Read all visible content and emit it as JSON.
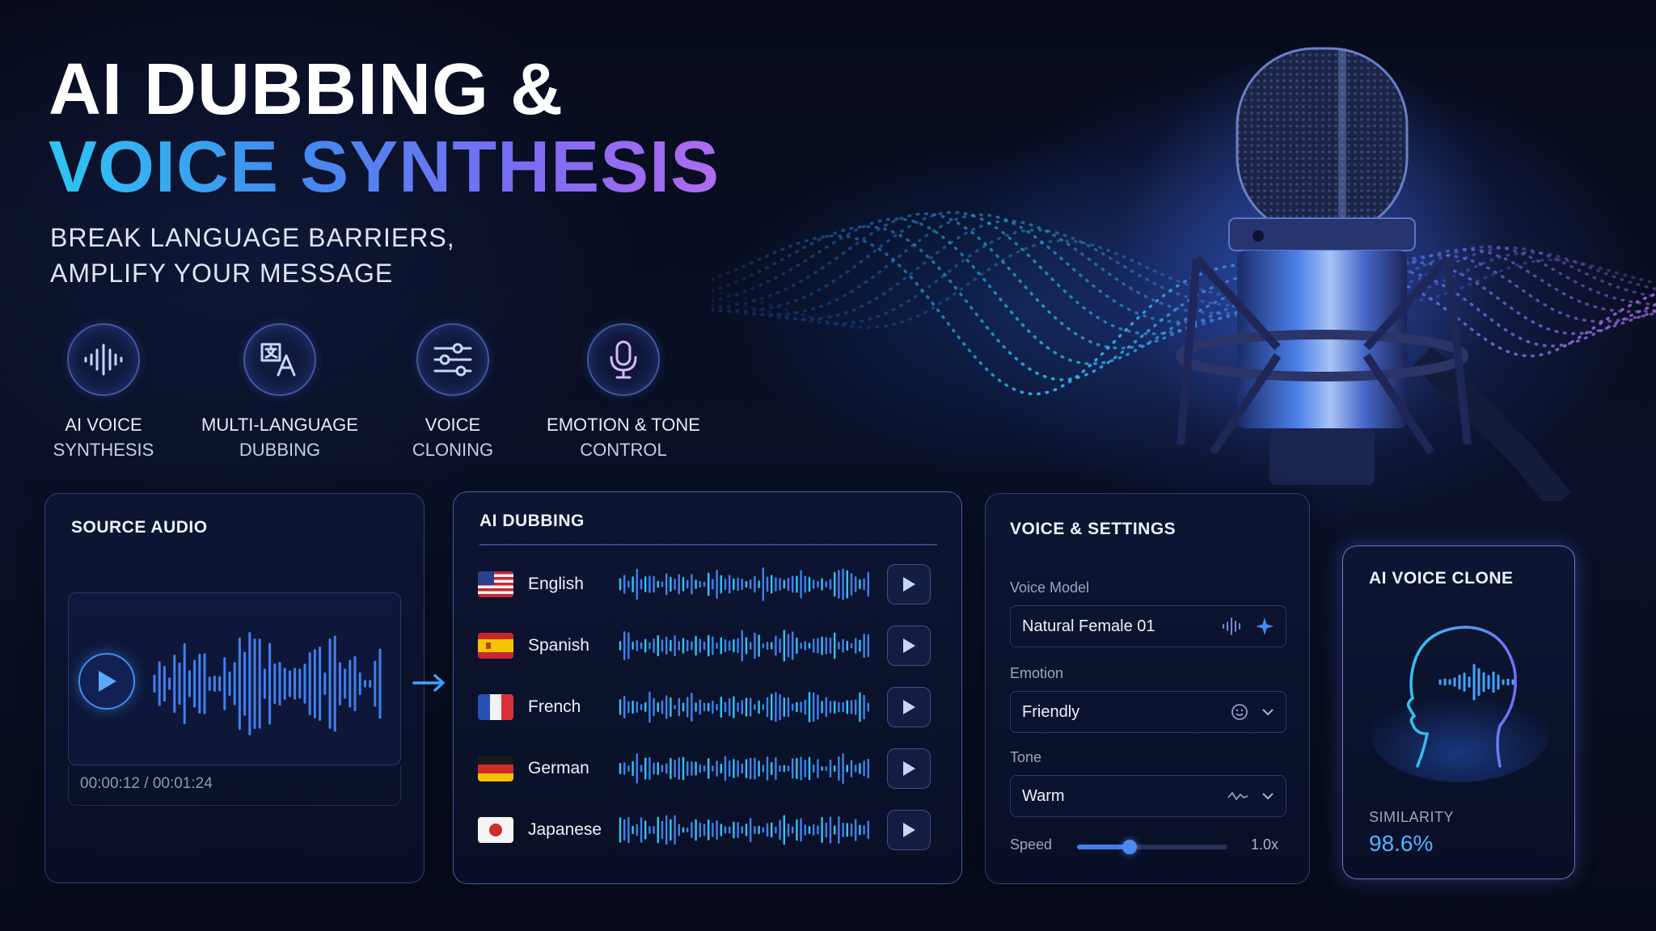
{
  "hero": {
    "title_line1": "AI DUBBING &",
    "title_line2": "VOICE SYNTHESIS",
    "subtitle_line1": "BREAK LANGUAGE BARRIERS,",
    "subtitle_line2": "AMPLIFY YOUR MESSAGE"
  },
  "features": [
    {
      "icon": "waveform-icon",
      "line1": "AI VOICE",
      "line2": "SYNTHESIS"
    },
    {
      "icon": "translate-icon",
      "line1": "MULTI-LANGUAGE",
      "line2": "DUBBING"
    },
    {
      "icon": "sliders-icon",
      "line1": "VOICE",
      "line2": "CLONING"
    },
    {
      "icon": "microphone-icon",
      "line1": "EMOTION & TONE",
      "line2": "CONTROL"
    }
  ],
  "source_audio": {
    "title": "SOURCE AUDIO",
    "time_current": "00:00:12",
    "time_separator": " / ",
    "time_total": "00:01:24"
  },
  "ai_dubbing": {
    "title": "AI DUBBING",
    "languages": [
      {
        "name": "English",
        "flag": "us-flag-icon"
      },
      {
        "name": "Spanish",
        "flag": "spain-flag-icon"
      },
      {
        "name": "French",
        "flag": "france-flag-icon"
      },
      {
        "name": "German",
        "flag": "germany-flag-icon"
      },
      {
        "name": "Japanese",
        "flag": "japan-flag-icon"
      }
    ]
  },
  "voice_settings": {
    "title": "VOICE & SETTINGS",
    "voice_model_label": "Voice Model",
    "voice_model_value": "Natural Female 01",
    "emotion_label": "Emotion",
    "emotion_value": "Friendly",
    "tone_label": "Tone",
    "tone_value": "Warm",
    "speed_label": "Speed",
    "speed_value": "1.0x",
    "speed_slider_fraction": 0.35
  },
  "voice_clone": {
    "title": "AI VOICE CLONE",
    "similarity_label": "SIMILARITY",
    "similarity_value": "98.6%"
  },
  "colors": {
    "accent_cyan": "#2ec6f2",
    "accent_blue": "#3f8df0",
    "accent_purple": "#b06cf0",
    "panel_border": "#5f73be",
    "background": "#0a1128"
  }
}
